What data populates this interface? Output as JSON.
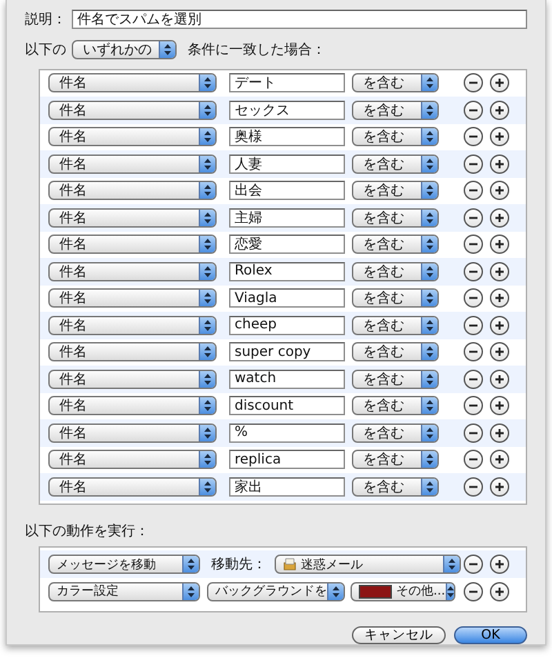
{
  "description": {
    "label": "説明：",
    "value": "件名でスパムを選別"
  },
  "match": {
    "prefix": "以下の",
    "value": "いずれかの",
    "suffix": "条件に一致した場合："
  },
  "conditions": [
    {
      "field": "件名",
      "value": "デート",
      "operator": "を含む"
    },
    {
      "field": "件名",
      "value": "セックス",
      "operator": "を含む"
    },
    {
      "field": "件名",
      "value": "奥様",
      "operator": "を含む"
    },
    {
      "field": "件名",
      "value": "人妻",
      "operator": "を含む"
    },
    {
      "field": "件名",
      "value": "出会",
      "operator": "を含む"
    },
    {
      "field": "件名",
      "value": "主婦",
      "operator": "を含む"
    },
    {
      "field": "件名",
      "value": "恋愛",
      "operator": "を含む"
    },
    {
      "field": "件名",
      "value": "Rolex",
      "operator": "を含む"
    },
    {
      "field": "件名",
      "value": "Viagla",
      "operator": "を含む"
    },
    {
      "field": "件名",
      "value": "cheep",
      "operator": "を含む"
    },
    {
      "field": "件名",
      "value": "super copy",
      "operator": "を含む"
    },
    {
      "field": "件名",
      "value": "watch",
      "operator": "を含む"
    },
    {
      "field": "件名",
      "value": "discount",
      "operator": "を含む"
    },
    {
      "field": "件名",
      "value": "%",
      "operator": "を含む"
    },
    {
      "field": "件名",
      "value": "replica",
      "operator": "を含む"
    },
    {
      "field": "件名",
      "value": "家出",
      "operator": "を含む"
    }
  ],
  "actions_label": "以下の動作を実行：",
  "actions": [
    {
      "kind": "move",
      "action": "メッセージを移動",
      "label": "移動先：",
      "target": "迷惑メール"
    },
    {
      "kind": "color",
      "action": "カラー設定",
      "mode": "バックグラウンドを",
      "color": "#8c1414",
      "color_label": "その他..."
    }
  ],
  "buttons": [
    {
      "kind": "cancel",
      "label": "キャンセル"
    },
    {
      "kind": "default",
      "label": "OK"
    }
  ]
}
